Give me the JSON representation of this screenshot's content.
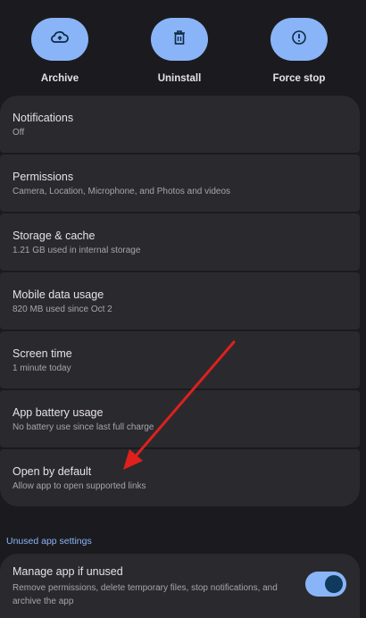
{
  "actions": [
    {
      "label": "Archive",
      "icon": "cloud-upload-icon"
    },
    {
      "label": "Uninstall",
      "icon": "trash-icon"
    },
    {
      "label": "Force stop",
      "icon": "alert-circle-icon"
    }
  ],
  "settings": [
    {
      "title": "Notifications",
      "subtitle": "Off"
    },
    {
      "title": "Permissions",
      "subtitle": "Camera, Location, Microphone, and Photos and videos"
    },
    {
      "title": "Storage & cache",
      "subtitle": "1.21 GB used in internal storage"
    },
    {
      "title": "Mobile data usage",
      "subtitle": "820 MB used since Oct 2"
    },
    {
      "title": "Screen time",
      "subtitle": "1 minute today"
    },
    {
      "title": "App battery usage",
      "subtitle": "No battery use since last full charge"
    },
    {
      "title": "Open by default",
      "subtitle": "Allow app to open supported links"
    }
  ],
  "unused_section": {
    "header": "Unused app settings",
    "manage_title": "Manage app if unused",
    "manage_subtitle": "Remove permissions, delete temporary files, stop notifications, and archive the app",
    "toggle_on": true
  },
  "colors": {
    "accent": "#8ab4f8",
    "annotation_arrow": "#e0201c"
  }
}
